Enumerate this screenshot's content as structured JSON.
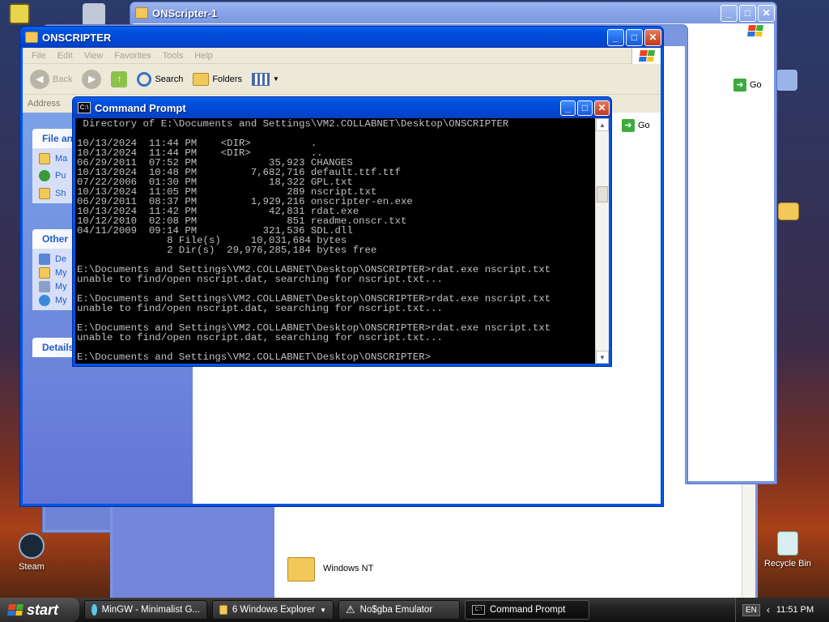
{
  "desktop": {
    "icons": {
      "steam": "Steam",
      "recycle": "Recycle Bin"
    }
  },
  "win_back": {
    "title": "ONScripter-1",
    "go_label": "Go",
    "folder_label": "Windows NT"
  },
  "explorer": {
    "title": "ONSCRIPTER",
    "menu": [
      "File",
      "Edit",
      "View",
      "Favorites",
      "Tools",
      "Help"
    ],
    "toolbar": {
      "back": "Back",
      "search": "Search",
      "folders": "Folders"
    },
    "address_label": "Address",
    "go_label": "Go",
    "pane_file": "File and",
    "pane_other": "Other",
    "pane_details": "Details",
    "file_tasks": [
      "Ma",
      "Pu",
      "Sh"
    ],
    "other_places": [
      "De",
      "My",
      "My",
      "My"
    ]
  },
  "cmd": {
    "title": "Command Prompt",
    "lines": [
      " Directory of E:\\Documents and Settings\\VM2.COLLABNET\\Desktop\\ONSCRIPTER",
      "",
      "10/13/2024  11:44 PM    <DIR>          .",
      "10/13/2024  11:44 PM    <DIR>          ..",
      "06/29/2011  07:52 PM            35,923 CHANGES",
      "10/13/2024  10:48 PM         7,682,716 default.ttf.ttf",
      "07/22/2006  01:30 PM            18,322 GPL.txt",
      "10/13/2024  11:05 PM               289 nscript.txt",
      "06/29/2011  08:37 PM         1,929,216 onscripter-en.exe",
      "10/13/2024  11:42 PM            42,831 rdat.exe",
      "10/12/2010  02:08 PM               851 readme.onscr.txt",
      "04/11/2009  09:14 PM           321,536 SDL.dll",
      "               8 File(s)     10,031,684 bytes",
      "               2 Dir(s)  29,976,285,184 bytes free",
      "",
      "E:\\Documents and Settings\\VM2.COLLABNET\\Desktop\\ONSCRIPTER>rdat.exe nscript.txt",
      "unable to find/open nscript.dat, searching for nscript.txt...",
      "",
      "E:\\Documents and Settings\\VM2.COLLABNET\\Desktop\\ONSCRIPTER>rdat.exe nscript.txt",
      "unable to find/open nscript.dat, searching for nscript.txt...",
      "",
      "E:\\Documents and Settings\\VM2.COLLABNET\\Desktop\\ONSCRIPTER>rdat.exe nscript.txt",
      "unable to find/open nscript.dat, searching for nscript.txt...",
      "",
      "E:\\Documents and Settings\\VM2.COLLABNET\\Desktop\\ONSCRIPTER>"
    ]
  },
  "taskbar": {
    "start": "start",
    "tasks": [
      "MinGW - Minimalist G...",
      "6 Windows Explorer",
      "No$gba Emulator",
      "Command Prompt"
    ],
    "lang": "EN",
    "clock": "11:51 PM"
  },
  "colors": {
    "xp_blue": "#0054e3",
    "console_text": "#c0c0c0"
  }
}
